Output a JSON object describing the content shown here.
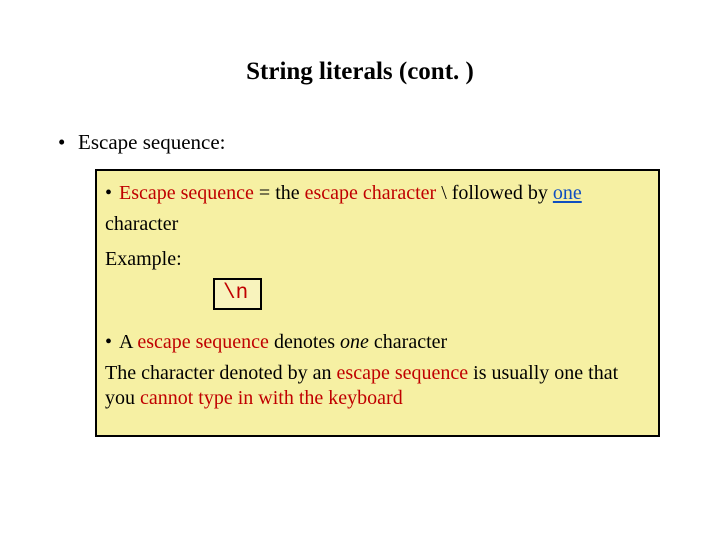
{
  "title": "String literals (cont. )",
  "bullet_main": "Escape sequence:",
  "box": {
    "def_pre": "Escape sequence",
    "def_eq": " = the ",
    "def_red1": "escape character",
    "def_bs": " \\ followed by ",
    "def_blue": "one",
    "def_after": "character",
    "example_label": "Example:",
    "code": "\\n",
    "line2_a": "A ",
    "line2_red": "escape sequence",
    "line2_b": " denotes ",
    "line2_em": "one",
    "line2_c": " character",
    "line3_a": "The character denoted by an ",
    "line3_red": "escape sequence",
    "line3_b": " is usually one that you ",
    "line3_red2": "cannot type in with the keyboard"
  }
}
